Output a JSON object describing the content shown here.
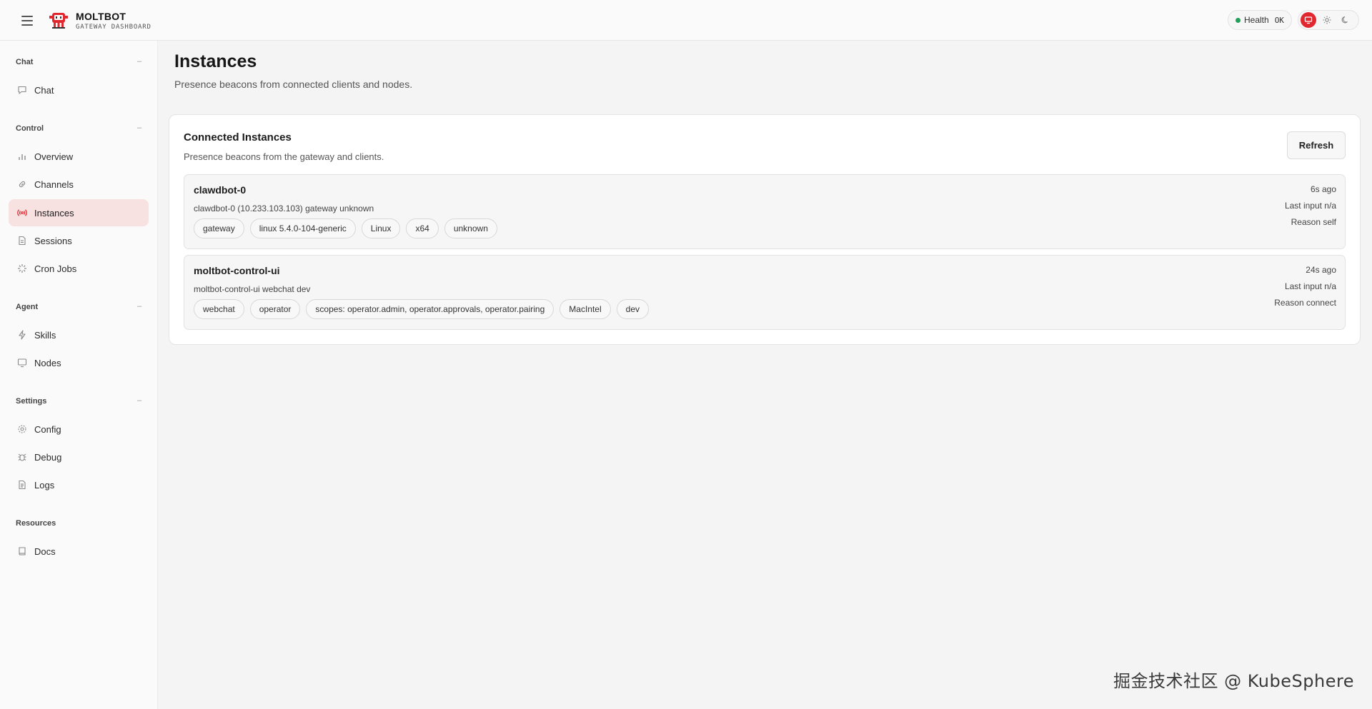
{
  "header": {
    "brand_name": "MOLTBOT",
    "brand_sub": "GATEWAY DASHBOARD",
    "health_label": "Health",
    "health_status": "OK",
    "health_color": "#22a05a",
    "accent_color": "#e0282e"
  },
  "sidebar": {
    "sections": {
      "chat": "Chat",
      "control": "Control",
      "agent": "Agent",
      "settings": "Settings",
      "resources": "Resources"
    },
    "collapse_glyph": "–",
    "items": {
      "chat": "Chat",
      "overview": "Overview",
      "channels": "Channels",
      "instances": "Instances",
      "sessions": "Sessions",
      "cron_jobs": "Cron Jobs",
      "skills": "Skills",
      "nodes": "Nodes",
      "config": "Config",
      "debug": "Debug",
      "logs": "Logs",
      "docs": "Docs"
    },
    "active_item": "instances"
  },
  "main": {
    "title": "Instances",
    "subtitle": "Presence beacons from connected clients and nodes.",
    "card": {
      "title": "Connected Instances",
      "subtitle": "Presence beacons from the gateway and clients.",
      "refresh_label": "Refresh",
      "instances": [
        {
          "name": "clawdbot-0",
          "desc": "clawdbot-0 (10.233.103.103) gateway unknown",
          "tags": [
            "gateway",
            "linux 5.4.0-104-generic",
            "Linux",
            "x64",
            "unknown"
          ],
          "age": "6s ago",
          "last_input": "Last input n/a",
          "reason": "Reason self"
        },
        {
          "name": "moltbot-control-ui",
          "desc": "moltbot-control-ui webchat dev",
          "tags": [
            "webchat",
            "operator",
            "scopes: operator.admin, operator.approvals, operator.pairing",
            "MacIntel",
            "dev"
          ],
          "age": "24s ago",
          "last_input": "Last input n/a",
          "reason": "Reason connect"
        }
      ]
    }
  },
  "watermark": "掘金技术社区 @ KubeSphere"
}
